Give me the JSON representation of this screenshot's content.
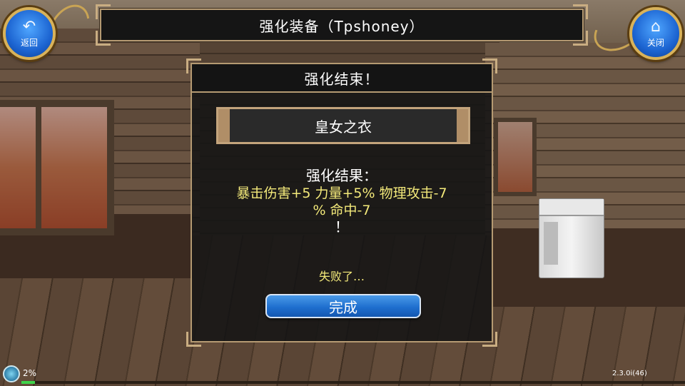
{
  "header": {
    "title": "强化装备（Tpshoney）",
    "back_label": "返回",
    "close_label": "关闭"
  },
  "panel": {
    "title": "强化结束！",
    "item_name": "皇女之衣",
    "result_label": "强化结果：",
    "result_line_1": "暴击伤害+5 力量+5% 物理攻击-7",
    "result_line_2": "% 命中-7",
    "result_mark": "！",
    "fail_text": "失败了…",
    "done_label": "完成"
  },
  "status": {
    "progress_text": "2%",
    "progress_fraction": 0.02,
    "version": "2.3.0i(46)"
  },
  "icons": {
    "back": "back-arrow-icon",
    "close": "home-icon",
    "status": "globe-icon"
  },
  "colors": {
    "accent_gold": "#b59a72",
    "result_yellow": "#f3e97a",
    "button_blue": "#1f6fcf"
  }
}
